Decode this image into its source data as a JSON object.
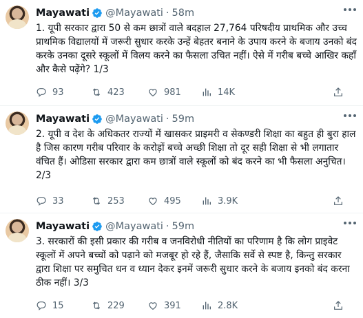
{
  "tweets": [
    {
      "name": "Mayawati",
      "handle": "@Mayawati",
      "separator": "·",
      "time": "58m",
      "text": "1. यूपी सरकार द्वारा 50 से कम छात्रों वाले बदहाल 27,764 परिषदीय प्राथमिक और उच्च प्राथमिक विद्यालयों में जरूरी सुधार करके उन्हें बेहतर बनाने के उपाय करने के बजाय उनको बंद करके उनका दूसरे स्कूलों में विलय करने का फैसला उचित नहीं। ऐसे में गरीब बच्चे आखिर कहाँ और कैसे पढ़ेंगे? 1/3",
      "replies": "93",
      "retweets": "423",
      "likes": "981",
      "views": "14K"
    },
    {
      "name": "Mayawati",
      "handle": "@Mayawati",
      "separator": "·",
      "time": "59m",
      "text": "2. यूपी व देश के अधिकतर राज्यों में खासकर प्राइमरी व सेकण्डरी शिक्षा का बहुत ही बुरा हाल है जिस कारण गरीब परिवार के करोड़ों बच्चे अच्छी शिक्षा तो दूर सही शिक्षा से भी लगातार वंचित हैं। ओडिसा सरकार द्वारा कम छात्रों वाले स्कूलों को बंद करने का भी फैसला अनुचित। 2/3",
      "replies": "33",
      "retweets": "253",
      "likes": "495",
      "views": "3.9K"
    },
    {
      "name": "Mayawati",
      "handle": "@Mayawati",
      "separator": "·",
      "time": "59m",
      "text": "3. सरकारों की इसी प्रकार की गरीब व जनविरोधी नीतियों का परिणाम है कि लोग प्राइवेट स्कूलों में अपने बच्चों को पढ़ाने को मजबूर हो रहे हैं, जैसाकि सर्वे से स्पष्ट है, किन्तु सरकार द्वारा शिक्षा पर समुचित धन व ध्यान देकर इनमें जरूरी सुधार करने के बजाय इनको बंद करना ठीक नहीं। 3/3",
      "replies": "15",
      "retweets": "229",
      "likes": "391",
      "views": "2.8K"
    }
  ],
  "colors": {
    "verified": "#1d9bf0",
    "muted": "#536471",
    "text": "#0f1419",
    "divider": "#eff3f4"
  },
  "icons": [
    "verified-badge-icon",
    "more-icon",
    "reply-icon",
    "retweet-icon",
    "like-icon",
    "views-icon",
    "share-icon"
  ]
}
